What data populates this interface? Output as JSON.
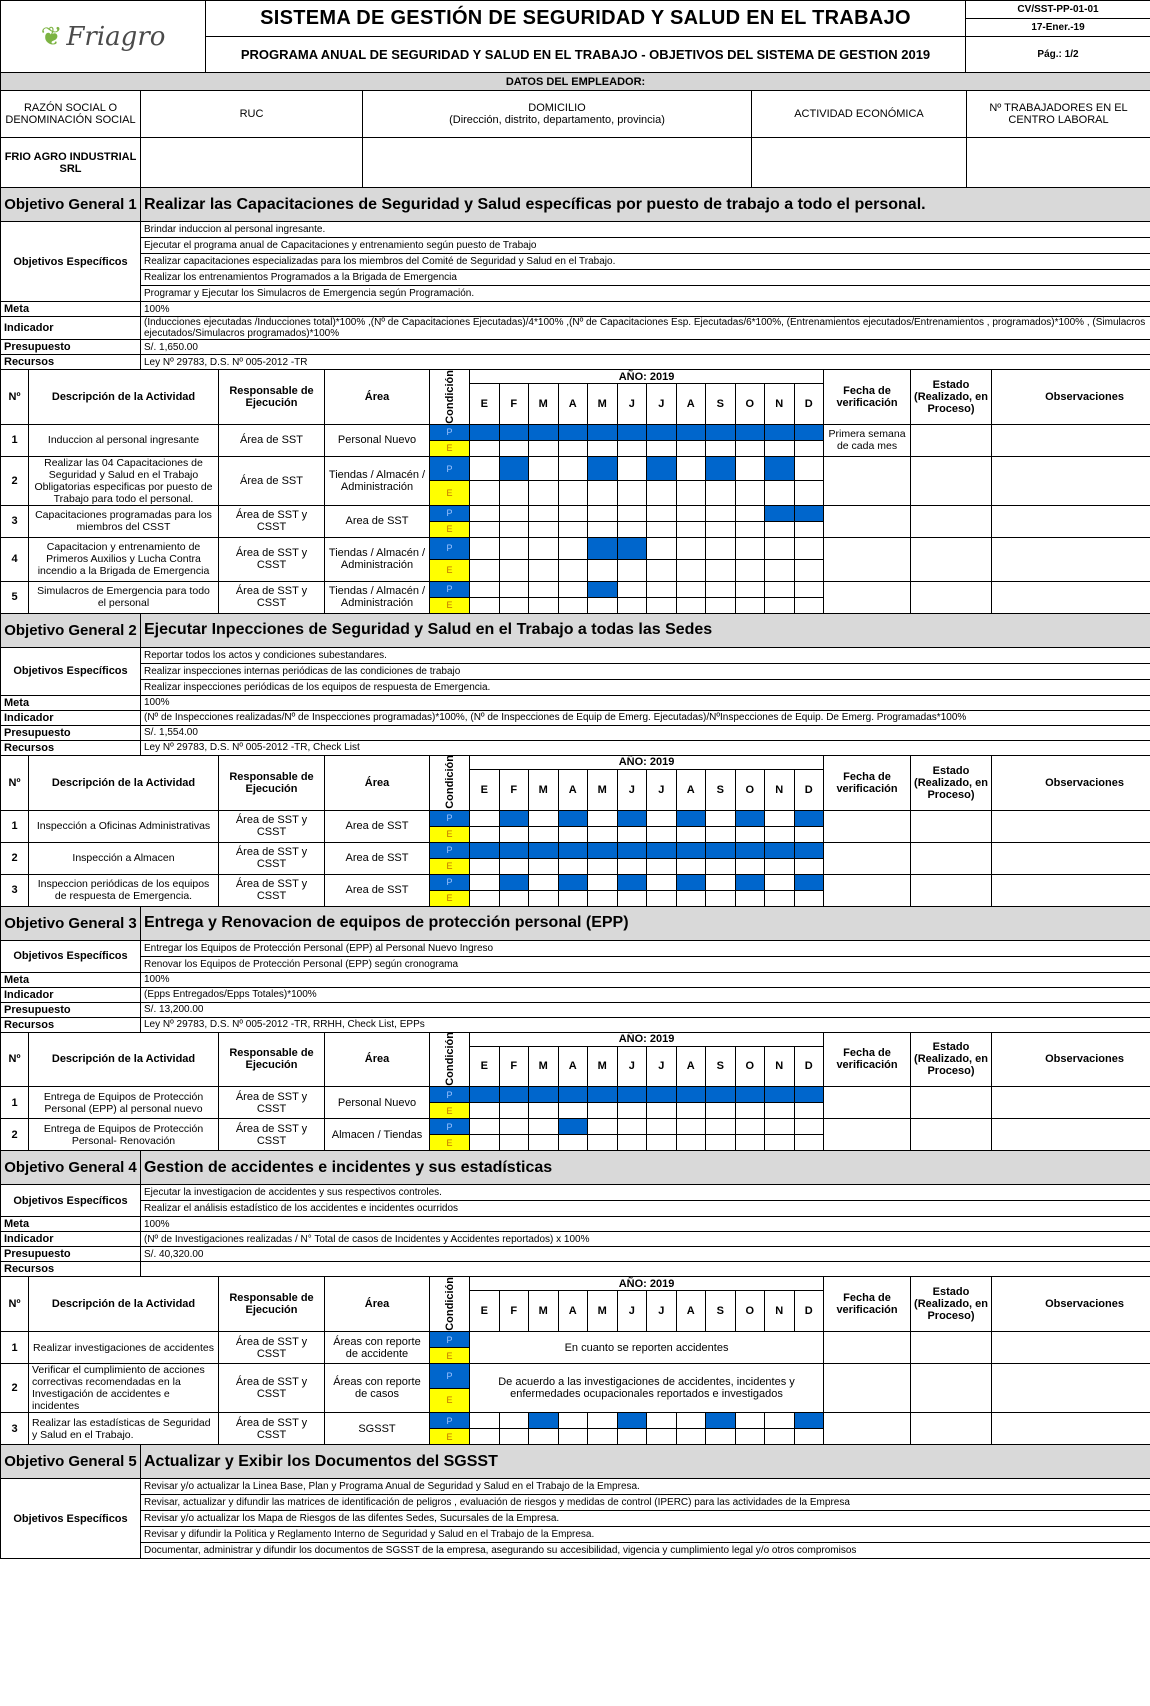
{
  "colors": {
    "plan": "#0066cc",
    "exec": "#ffff00",
    "band": "#d9d9d9"
  },
  "header": {
    "logo_text": "Friagro",
    "title": "SISTEMA DE GESTIÓN DE SEGURIDAD Y SALUD EN EL TRABAJO",
    "subtitle": "PROGRAMA ANUAL DE SEGURIDAD Y SALUD EN EL TRABAJO - OBJETIVOS DEL SISTEMA DE GESTION 2019",
    "code": "CV/SST-PP-01-01",
    "date": "17-Ener.-19",
    "page": "Pág.: 1/2"
  },
  "employer": {
    "band": "DATOS DEL EMPLEADOR:",
    "headers": [
      "RAZÓN SOCIAL O DENOMINACIÓN SOCIAL",
      "RUC",
      "DOMICILIO",
      "(Dirección, distrito, departamento, provincia)",
      "ACTIVIDAD ECONÓMICA",
      "Nº TRABAJADORES EN EL CENTRO LABORAL"
    ],
    "company": "FRIO AGRO INDUSTRIAL SRL"
  },
  "labels": {
    "especificos": "Objetivos Específicos",
    "meta": "Meta",
    "indicador": "Indicador",
    "presupuesto": "Presupuesto",
    "recursos": "Recursos",
    "n": "Nº",
    "descripcion": "Descripción de la Actividad",
    "responsable": "Responsable de Ejecución",
    "area": "Área",
    "condicion": "Condición",
    "anio": "AÑO: 2019",
    "fecha": "Fecha de verificación",
    "estado": "Estado (Realizado, en Proceso)",
    "observaciones": "Observaciones",
    "p": "P",
    "e": "E"
  },
  "months": [
    "E",
    "F",
    "M",
    "A",
    "M",
    "J",
    "J",
    "A",
    "S",
    "O",
    "N",
    "D"
  ],
  "objectives": [
    {
      "num": "Objetivo General 1",
      "title": "Realizar las  Capacitaciones de Seguridad y Salud específicas por puesto de trabajo a todo el personal.",
      "specific": [
        "Brindar induccion al personal ingresante.",
        "Ejecutar el  programa anual de Capacitaciones y entrenamiento según puesto de Trabajo",
        "Realizar capacitaciones especializadas para los miembros del  Comité de Seguridad y Salud en el Trabajo.",
        "Realizar los entrenamientos Programados a la Brigada de Emergencia",
        "Programar y Ejecutar los Simulacros de Emergencia según Programación."
      ],
      "meta": "100%",
      "indicador": "(Inducciones ejecutadas /Inducciones total)*100% ,(Nº de Capacitaciones Ejecutadas)/4*100% ,(Nº de Capacitaciones  Esp. Ejecutadas/6*100%,  (Entrenamientos ejecutados/Entrenamientos , programados)*100% , (Simulacros ejecutados/Simulacros programados)*100%",
      "presupuesto": "S/. 1,650.00",
      "recursos": "Ley Nº 29783, D.S. Nº 005-2012 -TR",
      "activities": [
        {
          "n": "1",
          "desc": "Induccion al personal ingresante",
          "resp": "Área de SST",
          "area": "Personal Nuevo",
          "plan": [
            1,
            1,
            1,
            1,
            1,
            1,
            1,
            1,
            1,
            1,
            1,
            1
          ],
          "fecha": "Primera semana de cada mes"
        },
        {
          "n": "2",
          "desc": "Realizar las 04 Capacitaciones de Seguridad y Salud en el Trabajo Obligatorias especificas por puesto de Trabajo para todo el personal.",
          "resp": "Área de SST",
          "area": "Tiendas / Almacén / Administración",
          "plan": [
            0,
            1,
            0,
            0,
            1,
            0,
            1,
            0,
            1,
            0,
            1,
            0
          ],
          "fecha": ""
        },
        {
          "n": "3",
          "desc": "Capacitaciones programadas para los miembros del CSST",
          "resp": "Área de SST y CSST",
          "area": "Area de SST",
          "plan": [
            0,
            0,
            0,
            0,
            0,
            0,
            0,
            0,
            0,
            0,
            1,
            1
          ],
          "fecha": ""
        },
        {
          "n": "4",
          "desc": "Capacitacion y  entrenamiento de Primeros Auxilios y Lucha Contra incendio a la Brigada de Emergencia",
          "resp": "Área de SST y CSST",
          "area": "Tiendas / Almacén / Administración",
          "plan": [
            0,
            0,
            0,
            0,
            1,
            1,
            0,
            0,
            0,
            0,
            0,
            0
          ],
          "fecha": ""
        },
        {
          "n": "5",
          "desc": "Simulacros de Emergencia para todo el personal",
          "resp": "Área de SST y CSST",
          "area": "Tiendas / Almacén / Administración",
          "plan": [
            0,
            0,
            0,
            0,
            1,
            0,
            0,
            0,
            0,
            0,
            0,
            0
          ],
          "fecha": ""
        }
      ]
    },
    {
      "num": "Objetivo General 2",
      "title": "Ejecutar Inpecciones de Seguridad y Salud en el Trabajo a todas las Sedes",
      "specific": [
        "Reportar todos los actos y condiciones subestandares.",
        "Realizar inspecciones internas periódicas de las condiciones de trabajo",
        "Realizar inspecciones periódicas de los equipos de respuesta de Emergencia."
      ],
      "meta": "100%",
      "indicador": "(Nº de Inspecciones realizadas/Nº de Inspecciones programadas)*100%, (Nº de Inspecciones de Equip de Emerg. Ejecutadas)/NºInspecciones de Equip. De Emerg. Programadas*100%",
      "presupuesto": "S/. 1,554.00",
      "recursos": "Ley Nº 29783, D.S. Nº 005-2012 -TR, Check List",
      "activities": [
        {
          "n": "1",
          "desc": "Inspección a Oficinas Administrativas",
          "resp": "Área de SST y CSST",
          "area": "Area de SST",
          "plan": [
            0,
            1,
            0,
            1,
            0,
            1,
            0,
            1,
            0,
            1,
            0,
            1
          ],
          "fecha": ""
        },
        {
          "n": "2",
          "desc": "Inspección a Almacen",
          "resp": "Área de SST y CSST",
          "area": "Area de SST",
          "plan": [
            1,
            1,
            1,
            1,
            1,
            1,
            1,
            1,
            1,
            1,
            1,
            1
          ],
          "fecha": ""
        },
        {
          "n": "3",
          "desc": "Inspeccion periódicas de los equipos de respuesta de Emergencia.",
          "resp": "Área de SST y CSST",
          "area": "Area de SST",
          "plan": [
            0,
            1,
            0,
            1,
            0,
            1,
            0,
            1,
            0,
            1,
            0,
            1
          ],
          "fecha": ""
        }
      ]
    },
    {
      "num": "Objetivo General 3",
      "title": "Entrega  y Renovacion de equipos de protección personal (EPP)",
      "specific": [
        "Entregar los Equipos de Protección Personal (EPP) al Personal Nuevo Ingreso",
        "Renovar los  Equipos de Protección Personal (EPP) según cronograma"
      ],
      "meta": "100%",
      "indicador": "(Epps Entregados/Epps Totales)*100%",
      "presupuesto": "S/. 13,200.00",
      "recursos": "Ley Nº 29783, D.S. Nº 005-2012 -TR, RRHH, Check List, EPPs",
      "activities": [
        {
          "n": "1",
          "desc": "Entrega de Equipos de Protección Personal (EPP)  al personal nuevo",
          "resp": "Área de SST y CSST",
          "area": "Personal Nuevo",
          "plan": [
            1,
            1,
            1,
            1,
            1,
            1,
            1,
            1,
            1,
            1,
            1,
            1
          ],
          "fecha": ""
        },
        {
          "n": "2",
          "desc": "Entrega de Equipos de Protección Personal- Renovación",
          "resp": "Área de SST y CSST",
          "area": "Almacen / Tiendas",
          "plan": [
            0,
            0,
            0,
            1,
            0,
            0,
            0,
            0,
            0,
            0,
            0,
            0
          ],
          "fecha": ""
        }
      ]
    },
    {
      "num": "Objetivo General 4",
      "title": "Gestion de accidentes e incidentes y sus estadísticas",
      "specific": [
        "Ejecutar la investigacion de accidentes y sus respectivos controles.",
        "Realizar el análisis estadístico de los accidentes e incidentes ocurridos"
      ],
      "meta": "100%",
      "indicador": "(Nº de Investigaciones realizadas / N° Total de casos de Incidentes y Accidentes reportados) x 100%",
      "presupuesto": "S/. 40,320.00",
      "recursos": "",
      "activities": [
        {
          "n": "1",
          "desc": "Realizar investigaciones de accidentes",
          "resp": "Área de SST y CSST",
          "area": "Áreas con reporte de accidente",
          "note": "En cuanto se reporten accidentes",
          "fecha": ""
        },
        {
          "n": "2",
          "desc": "Verificar el cumplimiento de acciones correctivas  recomendadas en la Investigación de accidentes e incidentes",
          "resp": "Área de SST y CSST",
          "area": "Áreas con reporte de casos",
          "note": "De acuerdo a las investigaciones de accidentes, incidentes y enfermedades ocupacionales reportados e investigados",
          "fecha": ""
        },
        {
          "n": "3",
          "desc": "Realizar las estadísticas de Seguridad y Salud en el Trabajo.",
          "resp": "Área de SST y CSST",
          "area": "SGSST",
          "plan": [
            0,
            0,
            1,
            0,
            0,
            1,
            0,
            0,
            1,
            0,
            0,
            1
          ],
          "fecha": ""
        }
      ]
    },
    {
      "num": "Objetivo General 5",
      "title": "Actualizar y Exibir los Documentos del SGSST",
      "specific": [
        "Revisar y/o actualizar la Linea Base, Plan y Programa Anual de Seguridad y Salud en el Trabajo de la Empresa.",
        "Revisar, actualizar y difundir las matrices de identificación de peligros , evaluación de riesgos y medidas de control (IPERC) para las actividades de la Empresa",
        "Revisar y/o actualizar los Mapa de Riesgos de las difentes Sedes, Sucursales de la  Empresa.",
        "Revisar  y difundir la Politica y Reglamento Interno de Seguridad y Salud en el Trabajo de la Empresa.",
        "Documentar, administrar y difundir los documentos de SGSST de la empresa, asegurando su accesibilidad, vigencia y cumplimiento legal y/o otros compromisos"
      ]
    }
  ]
}
